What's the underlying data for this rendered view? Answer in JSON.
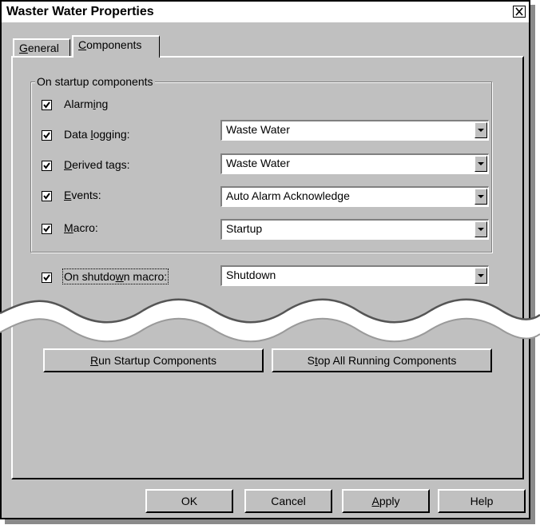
{
  "window": {
    "title": "Waster Water Properties"
  },
  "tabs": [
    {
      "label": "General",
      "mnemonic": "G",
      "rest": "eneral"
    },
    {
      "label": "Components",
      "mnemonic": "C",
      "rest": "omponents"
    }
  ],
  "group": {
    "label": "On startup components"
  },
  "components": [
    {
      "pre": "Alarm",
      "mn": "i",
      "post": "ng",
      "checked": true
    },
    {
      "pre": "Data ",
      "mn": "l",
      "post": "ogging:",
      "checked": true,
      "value": "Waste Water"
    },
    {
      "pre": "",
      "mn": "D",
      "post": "erived tags:",
      "checked": true,
      "value": "Waste Water"
    },
    {
      "pre": "",
      "mn": "E",
      "post": "vents:",
      "checked": true,
      "value": "Auto Alarm Acknowledge"
    },
    {
      "pre": "",
      "mn": "M",
      "post": "acro:",
      "checked": true,
      "value": "Startup"
    }
  ],
  "shutdown": {
    "pre": "On shutdo",
    "mn": "w",
    "post": "n macro:",
    "checked": true,
    "value": "Shutdown"
  },
  "actions": {
    "run": {
      "mn": "R",
      "post": "un Startup Components"
    },
    "stop": {
      "pre": "S",
      "mn": "t",
      "post": "op All Running Components"
    }
  },
  "footer": {
    "ok": "OK",
    "cancel": "Cancel",
    "apply": {
      "mn": "A",
      "post": "pply"
    },
    "help": "Help"
  },
  "icons": {
    "close": "close-icon",
    "dropdown": "chevron-down-icon",
    "check": "checkmark-icon"
  }
}
